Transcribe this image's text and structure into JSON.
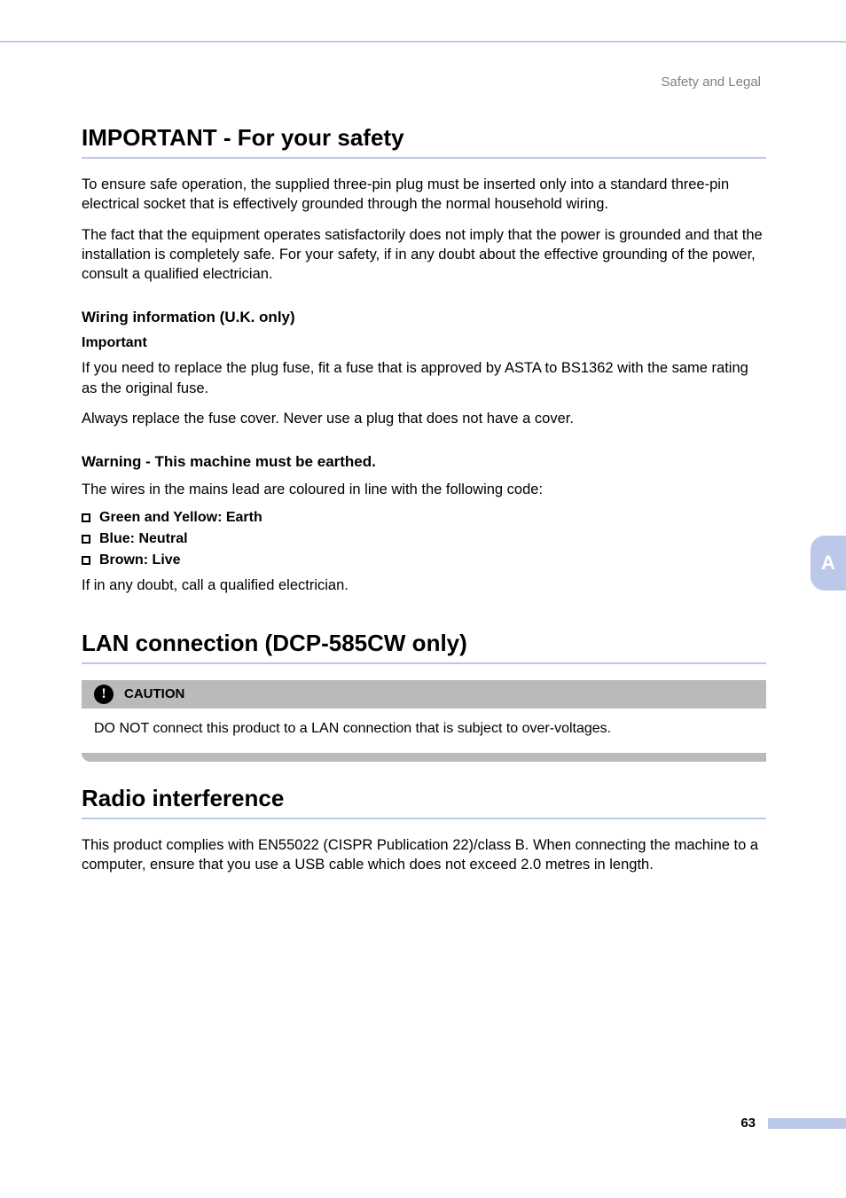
{
  "header": {
    "breadcrumb": "Safety and Legal"
  },
  "sideTab": {
    "letter": "A"
  },
  "pageNumber": "63",
  "sections": {
    "s1": {
      "title": "IMPORTANT - For your safety",
      "p1": "To ensure safe operation, the supplied three-pin plug must be inserted only into a standard three-pin electrical socket that is effectively grounded through the normal household wiring.",
      "p2": "The fact that the equipment operates satisfactorily does not imply that the power is grounded and that the installation is completely safe. For your safety, if in any doubt about the effective grounding of the power, consult a qualified electrician.",
      "sub1": {
        "title": "Wiring information (U.K. only)",
        "strong": "Important",
        "p1": "If you need to replace the plug fuse, fit a fuse that is approved by ASTA to BS1362 with the same rating as the original fuse.",
        "p2": "Always replace the fuse cover. Never use a plug that does not have a cover."
      },
      "sub2": {
        "title": "Warning - This machine must be earthed.",
        "p1": "The wires in the mains lead are coloured in line with the following code:",
        "bullets": [
          "Green and Yellow: Earth",
          "Blue: Neutral",
          "Brown: Live"
        ],
        "p2": "If in any doubt, call a qualified electrician."
      }
    },
    "s2": {
      "title": "LAN connection (DCP-585CW only)",
      "caution": {
        "label": "CAUTION",
        "body": "DO NOT connect this product to a LAN connection that is subject to over-voltages."
      }
    },
    "s3": {
      "title": "Radio interference",
      "p1": "This product complies with EN55022 (CISPR Publication 22)/class B. When connecting the machine to a computer, ensure that you use a USB cable which does not exceed 2.0 metres in length."
    }
  }
}
